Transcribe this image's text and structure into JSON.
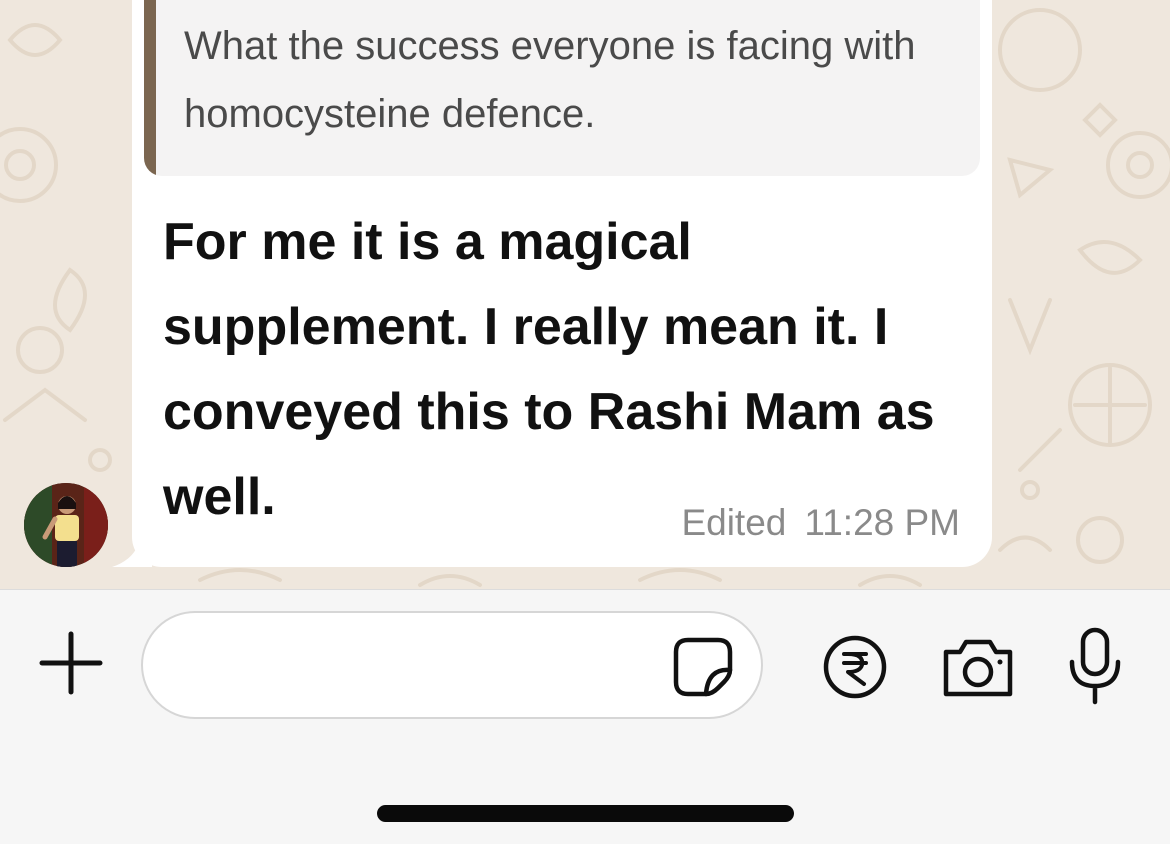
{
  "chat": {
    "quoted_message": {
      "text": "What the success everyone is facing with homocysteine defence."
    },
    "message": {
      "text": "For me it is a magical supplement.  I really mean it. I conveyed this to Rashi Mam as well.",
      "edited_label": "Edited",
      "time": "11:28 PM"
    },
    "avatar_icon": "contact-avatar"
  },
  "composer": {
    "input_value": "",
    "input_placeholder": "",
    "buttons": {
      "attach_icon": "plus-icon",
      "sticker_icon": "sticker-icon",
      "payment_icon": "rupee-icon",
      "camera_icon": "camera-icon",
      "mic_icon": "microphone-icon"
    }
  },
  "colors": {
    "wallpaper": "#efe7dd",
    "bubble": "#ffffff",
    "quote_bar": "#7b6650",
    "meta_text": "#8a8a8a"
  }
}
